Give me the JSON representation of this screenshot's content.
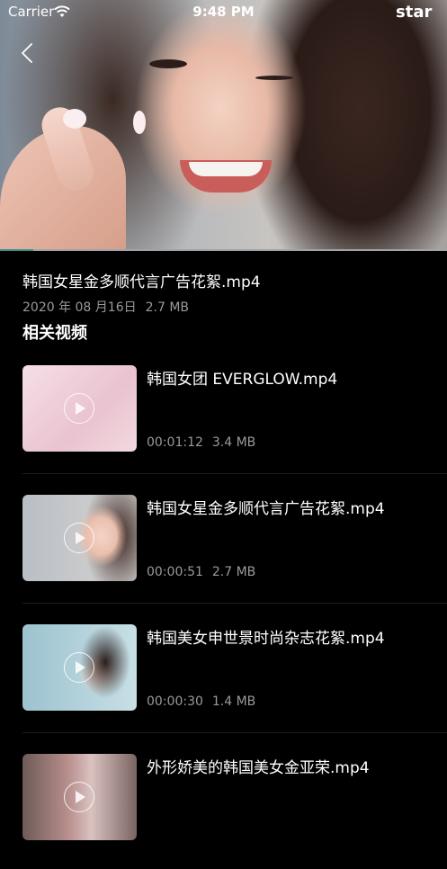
{
  "status_bar": {
    "carrier": "Carrier",
    "time": "9:48 PM",
    "watermark": "star"
  },
  "player": {
    "progress": 0.075
  },
  "video": {
    "title": "韩国女星金多顺代言广告花絮.mp4",
    "date": "2020 年 08 月16日",
    "size": "2.7 MB"
  },
  "section_title": "相关视频",
  "related": [
    {
      "name": "韩国女团 EVERGLOW.mp4",
      "duration": "00:01:12",
      "size": "3.4 MB"
    },
    {
      "name": "韩国女星金多顺代言广告花絮.mp4",
      "duration": "00:00:51",
      "size": "2.7 MB"
    },
    {
      "name": "韩国美女申世景时尚杂志花絮.mp4",
      "duration": "00:00:30",
      "size": "1.4 MB"
    },
    {
      "name": "外形娇美的韩国美女金亚荣.mp4",
      "duration": "",
      "size": ""
    }
  ],
  "colors": {
    "background": "#000000",
    "secondary_text": "#9a9a9a",
    "progress": "#3a8f8a"
  }
}
